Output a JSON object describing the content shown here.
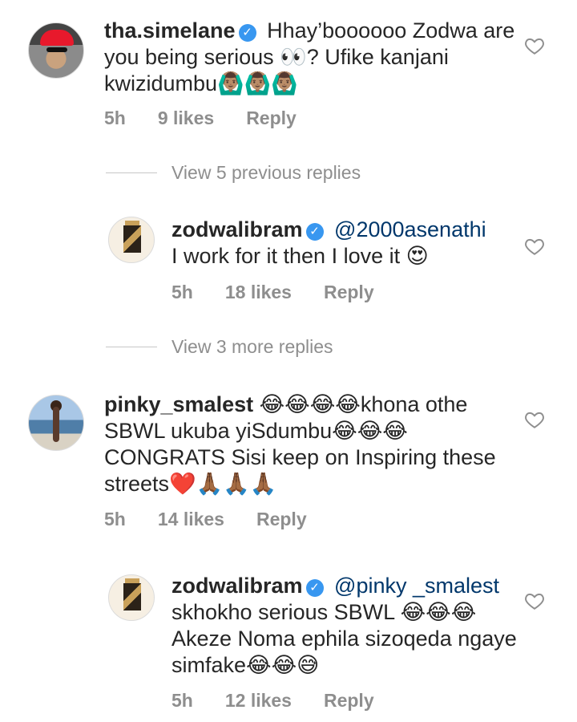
{
  "comments": [
    {
      "username": "tha.simelane",
      "verified": true,
      "text": "Hhay’boooooo Zodwa are you being serious 👀? Ufike kanjani kwizidumbu🙆🏽‍♂️🙆🏽‍♂️🙆🏽‍♂️",
      "time": "5h",
      "likes": "9 likes",
      "reply": "Reply"
    },
    {
      "username": "zodwalibram",
      "verified": true,
      "mention": "@2000asenathi",
      "text": "I work for it then I love it 😍",
      "time": "5h",
      "likes": "18 likes",
      "reply": "Reply"
    },
    {
      "username": "pinky_smalest",
      "verified": false,
      "text": "😂😂😂😂khona othe SBWL ukuba yiSdumbu😂😂😂 CONGRATS Sisi keep on Inspiring these streets❤️🙏🏾🙏🏾🙏🏾",
      "time": "5h",
      "likes": "14 likes",
      "reply": "Reply"
    },
    {
      "username": "zodwalibram",
      "verified": true,
      "mention": "@pinky _smalest",
      "text": "skhokho serious SBWL 😂😂😂 Akeze Noma ephila sizoqeda ngaye simfake😂😂😅",
      "time": "5h",
      "likes": "12 likes",
      "reply": "Reply"
    }
  ],
  "view_previous": "View 5 previous replies",
  "view_more": "View 3 more replies",
  "icons": {
    "like": "heart-outline-icon",
    "verified": "verified-badge-icon"
  },
  "colors": {
    "verified": "#3897f0",
    "mention": "#00376b",
    "muted": "#8e8e8e"
  }
}
